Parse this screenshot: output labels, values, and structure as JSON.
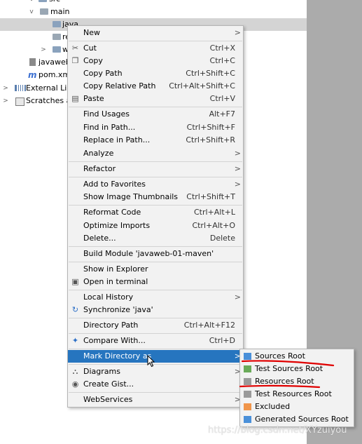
{
  "tree": {
    "items": [
      {
        "label": "src"
      },
      {
        "label": "main"
      },
      {
        "label": "java"
      },
      {
        "label": "re"
      },
      {
        "label": "w"
      },
      {
        "label": "javaweb"
      },
      {
        "label": "pom.xm"
      },
      {
        "label": "External Lib"
      },
      {
        "label": "Scratches a"
      }
    ]
  },
  "menu": {
    "items": [
      {
        "label": "New",
        "shortcut": ""
      },
      {
        "label": "Cut",
        "shortcut": "Ctrl+X"
      },
      {
        "label": "Copy",
        "shortcut": "Ctrl+C"
      },
      {
        "label": "Copy Path",
        "shortcut": "Ctrl+Shift+C"
      },
      {
        "label": "Copy Relative Path",
        "shortcut": "Ctrl+Alt+Shift+C"
      },
      {
        "label": "Paste",
        "shortcut": "Ctrl+V"
      },
      {
        "label": "Find Usages",
        "shortcut": "Alt+F7"
      },
      {
        "label": "Find in Path...",
        "shortcut": "Ctrl+Shift+F"
      },
      {
        "label": "Replace in Path...",
        "shortcut": "Ctrl+Shift+R"
      },
      {
        "label": "Analyze",
        "shortcut": ""
      },
      {
        "label": "Refactor",
        "shortcut": ""
      },
      {
        "label": "Add to Favorites",
        "shortcut": ""
      },
      {
        "label": "Show Image Thumbnails",
        "shortcut": "Ctrl+Shift+T"
      },
      {
        "label": "Reformat Code",
        "shortcut": "Ctrl+Alt+L"
      },
      {
        "label": "Optimize Imports",
        "shortcut": "Ctrl+Alt+O"
      },
      {
        "label": "Delete...",
        "shortcut": "Delete"
      },
      {
        "label": "Build Module 'javaweb-01-maven'",
        "shortcut": ""
      },
      {
        "label": "Show in Explorer",
        "shortcut": ""
      },
      {
        "label": "Open in terminal",
        "shortcut": ""
      },
      {
        "label": "Local History",
        "shortcut": ""
      },
      {
        "label": "Synchronize 'java'",
        "shortcut": ""
      },
      {
        "label": "Directory Path",
        "shortcut": "Ctrl+Alt+F12"
      },
      {
        "label": "Compare With...",
        "shortcut": "Ctrl+D"
      },
      {
        "label": "Mark Directory as",
        "shortcut": ""
      },
      {
        "label": "Diagrams",
        "shortcut": ""
      },
      {
        "label": "Create Gist...",
        "shortcut": ""
      },
      {
        "label": "WebServices",
        "shortcut": ""
      }
    ],
    "submenu_arrow": ">"
  },
  "submenu": {
    "items": [
      {
        "label": "Sources Root",
        "color": "#4a90d9"
      },
      {
        "label": "Test Sources Root",
        "color": "#6aab59"
      },
      {
        "label": "Resources Root",
        "color": "#9a9a9a"
      },
      {
        "label": "Test Resources Root",
        "color": "#9a9a9a"
      },
      {
        "label": "Excluded",
        "color": "#f0954a"
      },
      {
        "label": "Generated Sources Root",
        "color": "#4a90d9"
      }
    ]
  },
  "colors": {
    "menu_bg": "#f2f2f2",
    "selection": "#2675bf",
    "annotation": "#e00000"
  },
  "watermark": "https://blog.csdn.net/XYzuiyou"
}
